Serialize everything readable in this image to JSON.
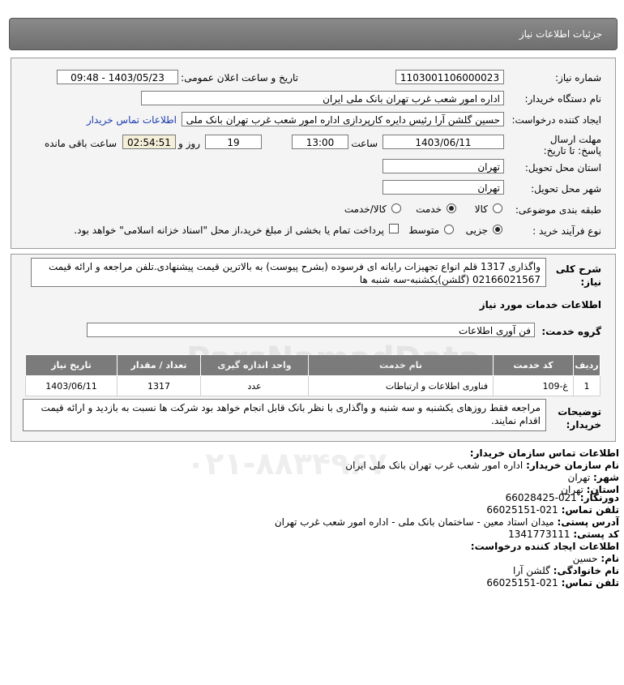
{
  "header": {
    "title": "جزئیات اطلاعات نیاز"
  },
  "need_number": {
    "label": "شماره نیاز:",
    "value": "1103001106000023"
  },
  "announce": {
    "label": "تاریخ و ساعت اعلان عمومی:",
    "value": "1403/05/23 - 09:48"
  },
  "buyer_org": {
    "label": "نام دستگاه خریدار:",
    "value": "اداره امور شعب غرب تهران بانک ملی ایران"
  },
  "creator": {
    "label": "ایجاد کننده درخواست:",
    "value": "حسین گلشن آرا رئیس دایره کارپردازی اداره امور شعب غرب تهران بانک ملی ایر",
    "link": "اطلاعات تماس خریدار"
  },
  "deadline": {
    "label": "مهلت ارسال پاسخ: تا تاریخ:",
    "date": "1403/06/11",
    "time_label": "ساعت",
    "time": "13:00",
    "days": "19",
    "days_label": "روز و",
    "remaining": "02:54:51",
    "remaining_label": "ساعت باقی مانده"
  },
  "province": {
    "label": "استان محل تحویل:",
    "value": "تهران"
  },
  "city": {
    "label": "شهر محل تحویل:",
    "value": "تهران"
  },
  "category": {
    "label": "طبقه بندی موضوعی:",
    "options": [
      "کالا",
      "خدمت",
      "کالا/خدمت"
    ],
    "selected": "خدمت"
  },
  "process": {
    "label": "نوع فرآیند خرید :",
    "options": [
      "جزیی",
      "متوسط"
    ],
    "selected": "جزیی",
    "treasury_text": "پرداخت تمام یا بخشی از مبلغ خرید،از محل \"اسناد خزانه اسلامی\" خواهد بود."
  },
  "description": {
    "label": "شرح کلی نیاز:",
    "text": "واگذاری 1317 قلم انواع تجهیزات رایانه ای فرسوده (بشرح پیوست) به بالاترین قیمت پیشنهادی.تلفن مراجعه و ارائه قیمت 02166021567 (گلشن)یکشنبه-سه شنبه ها"
  },
  "services_title": "اطلاعات خدمات مورد نیاز",
  "service_group": {
    "label": "گروه خدمت:",
    "value": "فن آوری اطلاعات"
  },
  "table": {
    "headers": [
      "ردیف",
      "کد خدمت",
      "نام خدمت",
      "واحد اندازه گیری",
      "تعداد / مقدار",
      "تاریخ نیاز"
    ],
    "rows": [
      [
        "1",
        "غ-109",
        "فناوری اطلاعات و ارتباطات",
        "عدد",
        "1317",
        "1403/06/11"
      ]
    ]
  },
  "buyer_notes": {
    "label": "توضیحات خریدار:",
    "text": "مراجعه فقط روزهای یکشنبه و سه شنبه و واگذاری با نظر بانک قابل انجام خواهد بود شرکت ها نسبت به بازدید و ارائه قیمت اقدام نمایند."
  },
  "contact": {
    "title": "اطلاعات تماس سازمان خریدار:",
    "org_label": "نام سازمان خریدار:",
    "org": "اداره امور شعب غرب تهران بانک ملی ایران",
    "city_label": "شهر:",
    "city": "تهران",
    "province_label": "استان:",
    "province": "تهران",
    "fax_label": "دورنگار:",
    "fax": "021-66028425",
    "phone_label": "تلفن تماس:",
    "phone": "021-66025151",
    "address_label": "آدرس پستی:",
    "address": "میدان استاد معین - ساختمان بانک ملی - اداره امور شعب غرب تهران",
    "postal_label": "کد پستی:",
    "postal": "1341773111",
    "creator_title": "اطلاعات ایجاد کننده درخواست:",
    "name_label": "نام:",
    "name": "حسین",
    "family_label": "نام خانوادگی:",
    "family": "گلشن آرا",
    "creator_phone_label": "تلفن تماس:",
    "creator_phone": "021-66025151"
  },
  "watermark": {
    "brand": "ParsNamadData",
    "phone": "۰۲۱-۸۸۳۴۹۶۷۰"
  }
}
